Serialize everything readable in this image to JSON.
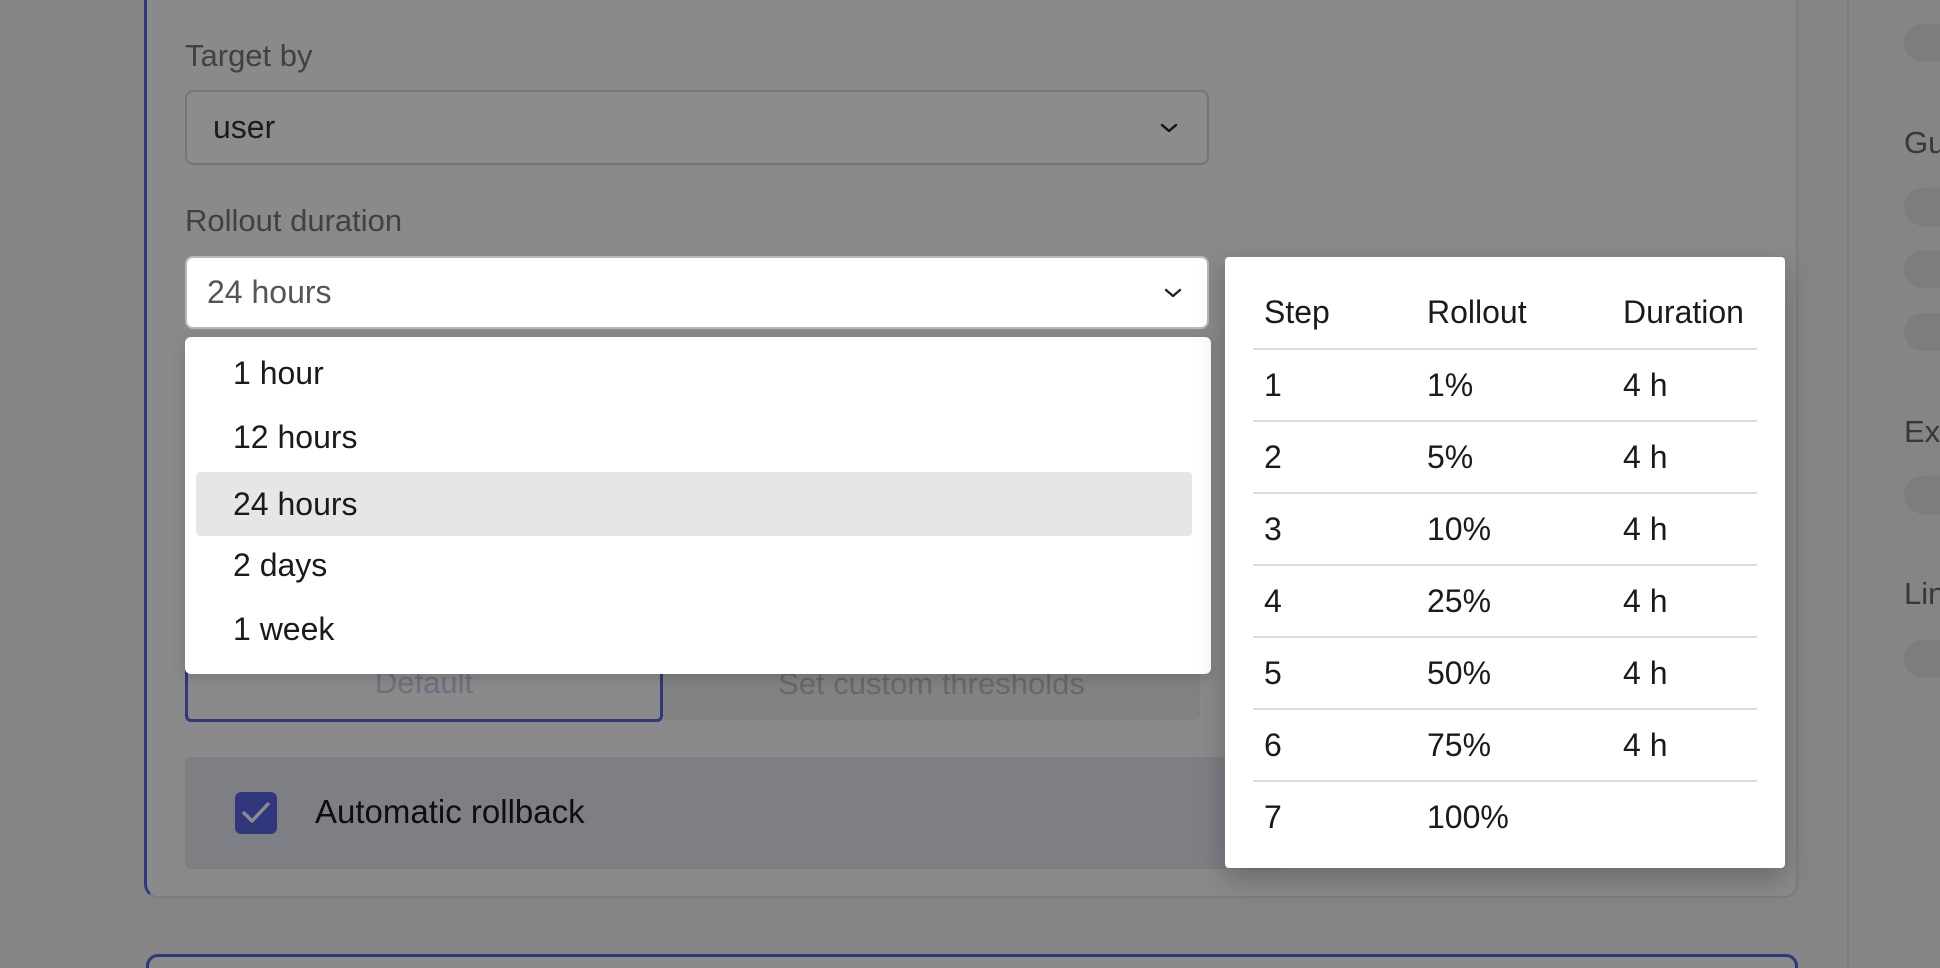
{
  "form": {
    "target_by": {
      "label": "Target by",
      "value": "user"
    },
    "rollout_duration": {
      "label": "Rollout duration",
      "value": "24 hours",
      "options": [
        {
          "label": "1 hour"
        },
        {
          "label": "12 hours"
        },
        {
          "label": "24 hours",
          "selected": true
        },
        {
          "label": "2 days"
        },
        {
          "label": "1 week"
        }
      ]
    },
    "thresholds": {
      "default_label": "Default",
      "custom_label": "Set custom thresholds"
    },
    "automatic_rollback": {
      "label": "Automatic rollback",
      "checked": true
    }
  },
  "rollout_steps": {
    "headers": [
      "Step",
      "Rollout",
      "Duration"
    ],
    "rows": [
      [
        "1",
        "1%",
        "4 h"
      ],
      [
        "2",
        "5%",
        "4 h"
      ],
      [
        "3",
        "10%",
        "4 h"
      ],
      [
        "4",
        "25%",
        "4 h"
      ],
      [
        "5",
        "50%",
        "4 h"
      ],
      [
        "6",
        "75%",
        "4 h"
      ],
      [
        "7",
        "100%",
        ""
      ]
    ]
  },
  "sidebar": {
    "labels": [
      "Gu",
      "Ex",
      "Lin"
    ]
  },
  "colors": {
    "accent": "#5865e0",
    "overlay": "rgba(0,0,0,0.45)",
    "selected_option_bg": "#e6e6e6"
  }
}
